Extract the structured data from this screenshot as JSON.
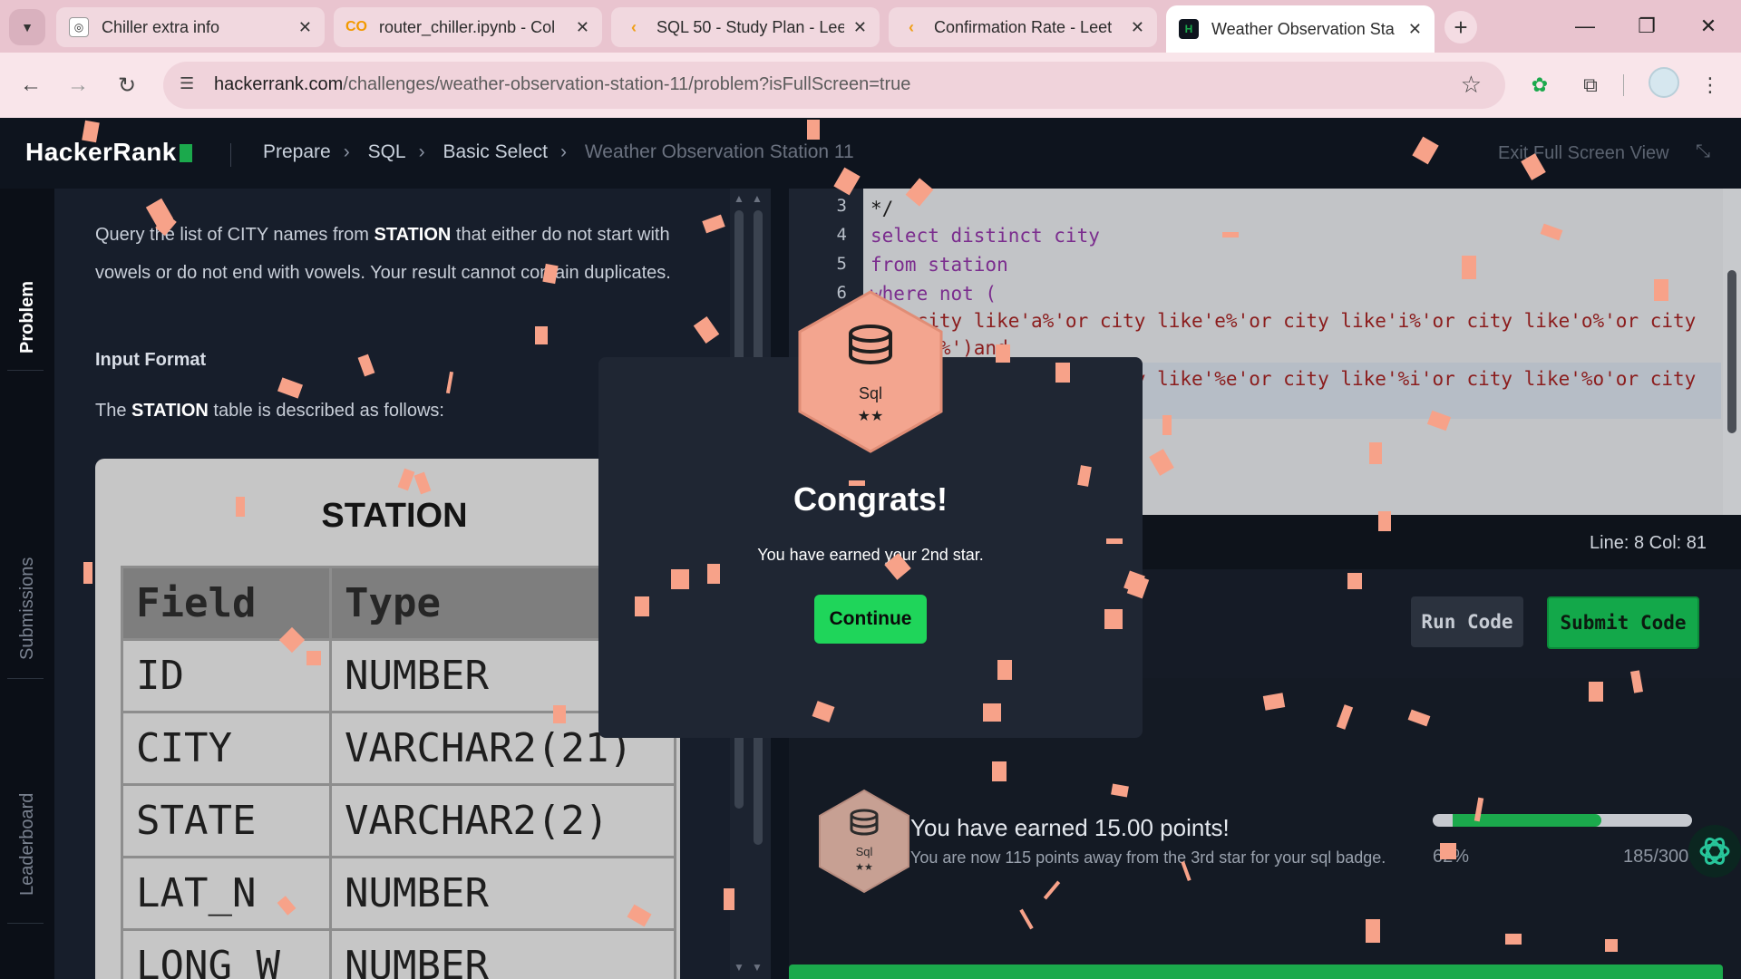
{
  "browser": {
    "tabs": [
      {
        "title": "Chiller extra info",
        "favicon": "chatgpt-icon"
      },
      {
        "title": "router_chiller.ipynb - Col",
        "favicon": "colab-icon"
      },
      {
        "title": "SQL 50 - Study Plan - Lee",
        "favicon": "leetcode-icon"
      },
      {
        "title": "Confirmation Rate - Leet",
        "favicon": "leetcode-icon"
      },
      {
        "title": "Weather Observation Sta",
        "favicon": "hackerrank-icon"
      }
    ],
    "url_host": "hackerrank.com",
    "url_path": "/challenges/weather-observation-station-11/problem?isFullScreen=true"
  },
  "header": {
    "logo": "HackerRank",
    "breadcrumbs": [
      "Prepare",
      "SQL",
      "Basic Select",
      "Weather Observation Station 11"
    ],
    "exit_fullscreen": "Exit Full Screen View"
  },
  "leftnav": {
    "problem": "Problem",
    "submissions": "Submissions",
    "leaderboard": "Leaderboard"
  },
  "problem": {
    "desc_1": "Query the list of CITY names from ",
    "desc_station": "STATION",
    "desc_2": " that either do not start with vowels or do not end with vowels. Your result cannot contain duplicates.",
    "input_format": "Input Format",
    "table_intro_1": "The ",
    "table_intro_station": "STATION",
    "table_intro_2": " table is described as follows:",
    "table_title": "STATION",
    "columns": [
      "Field",
      "Type"
    ],
    "rows": [
      [
        "ID",
        "NUMBER"
      ],
      [
        "CITY",
        "VARCHAR2(21)"
      ],
      [
        "STATE",
        "VARCHAR2(2)"
      ],
      [
        "LAT_N",
        "NUMBER"
      ],
      [
        "LONG_W",
        "NUMBER"
      ]
    ]
  },
  "editor": {
    "line_numbers": [
      "3",
      "4",
      "5",
      "6"
    ],
    "lines": [
      "*/",
      "select distinct city",
      "from station",
      "where not (",
      "    city like'a%'or city like'e%'or city like'i%'or city like'o%'or city",
      "like'u%')and",
      "    city like'%a'or city like'%e'or city like'%i'or city like'%o'or city"
    ],
    "status": "Line: 8 Col: 81",
    "run_label": "Run Code",
    "submit_label": "Submit Code"
  },
  "result": {
    "badge_name": "Sql",
    "badge_stars": "★★",
    "title": "You have earned 15.00 points!",
    "subtitle": "You are now 115 points away from the 3rd star for your sql badge.",
    "progress_text": "62%",
    "progress_fraction": 0.62,
    "points_text": "185/300"
  },
  "modal": {
    "badge_name": "Sql",
    "badge_stars": "★★",
    "title": "Congrats!",
    "message": "You have earned your 2nd star.",
    "continue_label": "Continue"
  },
  "colors": {
    "accent_green": "#1ba94c",
    "confetti": "#f7a289",
    "badge": "#f3a58f"
  }
}
